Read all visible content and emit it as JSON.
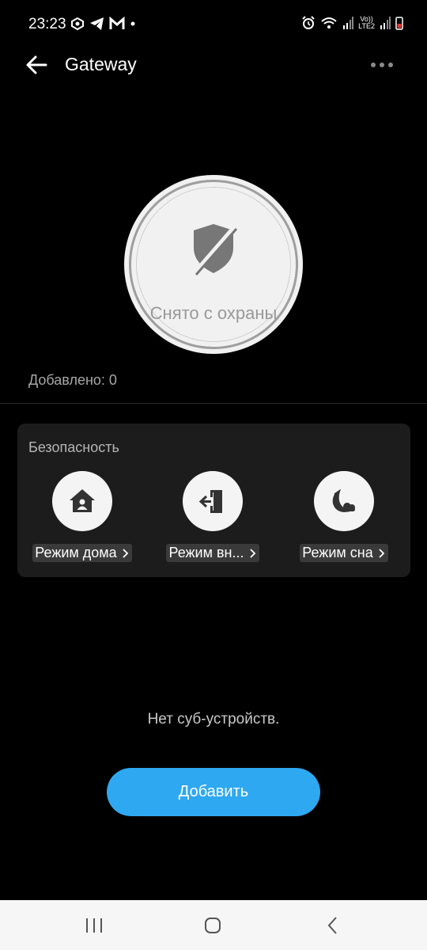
{
  "status_bar": {
    "time": "23:23",
    "network_label_top": "Vo))",
    "network_label_bottom": "LTE2"
  },
  "app_bar": {
    "title": "Gateway"
  },
  "arm_status": {
    "label": "Снято с охраны"
  },
  "added": {
    "text": "Добавлено: 0"
  },
  "security": {
    "title": "Безопасность",
    "modes": [
      {
        "label": "Режим дома",
        "icon": "home-person-icon"
      },
      {
        "label": "Режим вн...",
        "icon": "door-exit-icon"
      },
      {
        "label": "Режим сна",
        "icon": "moon-cloud-icon"
      }
    ]
  },
  "empty_state": {
    "text": "Нет суб-устройств."
  },
  "add_button": {
    "label": "Добавить"
  },
  "colors": {
    "background": "#000000",
    "card": "#1c1c1c",
    "accent": "#2ea8f0",
    "nav_bar": "#f6f6f6"
  }
}
